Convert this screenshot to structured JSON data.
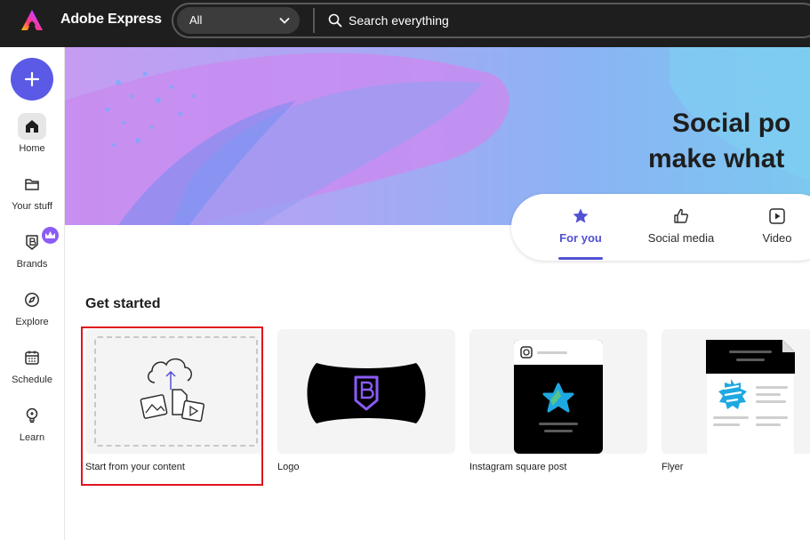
{
  "topbar": {
    "brand_name": "Adobe Express",
    "search_scope": "All",
    "search_placeholder": "Search everything"
  },
  "rail": {
    "create_icon": "plus-icon",
    "items": [
      {
        "label": "Home",
        "icon": "home-icon",
        "active": true
      },
      {
        "label": "Your stuff",
        "icon": "folder-icon"
      },
      {
        "label": "Brands",
        "icon": "brand-icon",
        "badge_icon": "crown-icon"
      },
      {
        "label": "Explore",
        "icon": "compass-icon"
      },
      {
        "label": "Schedule",
        "icon": "calendar-icon"
      },
      {
        "label": "Learn",
        "icon": "lightbulb-icon"
      }
    ]
  },
  "hero": {
    "title_line1": "Social po",
    "title_line2": "make what"
  },
  "tabs": [
    {
      "label": "For you",
      "icon": "star-icon",
      "active": true
    },
    {
      "label": "Social media",
      "icon": "thumbs-up-icon"
    },
    {
      "label": "Video",
      "icon": "play-icon"
    }
  ],
  "get_started": {
    "title": "Get started",
    "cards": [
      {
        "label": "Start from your content",
        "icon": "upload-cloud-icon",
        "selected": true
      },
      {
        "label": "Logo",
        "icon": "brand-logo-icon"
      },
      {
        "label": "Instagram square post",
        "icon": "instagram-icon"
      },
      {
        "label": "Flyer",
        "icon": "flyer-icon"
      }
    ]
  },
  "colors": {
    "topbar_bg": "#1e1e1e",
    "accent": "#5151d3",
    "create_button": "#5a5ae6",
    "highlight_border": "#e0141e"
  }
}
